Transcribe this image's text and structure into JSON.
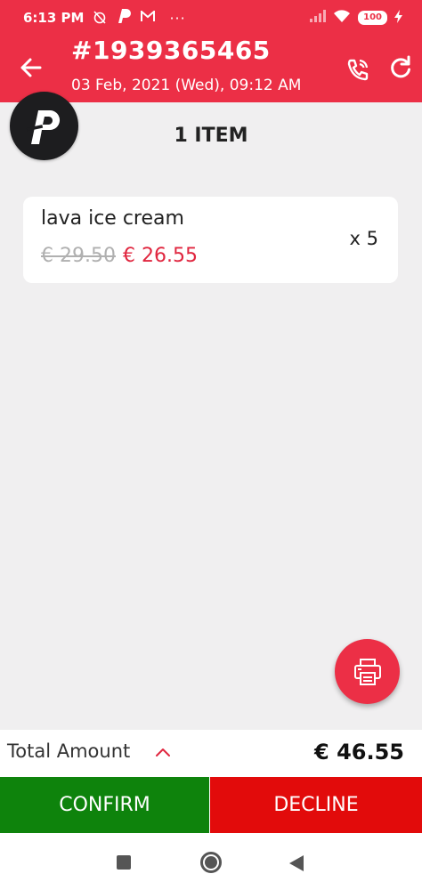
{
  "status_bar": {
    "time": "6:13 PM",
    "battery": "100"
  },
  "header": {
    "order_number": "#1939365465",
    "order_datetime": "03 Feb, 2021 (Wed), 09:12 AM"
  },
  "brand": {
    "logo_letter": "P"
  },
  "items_title": "1 ITEM",
  "items": [
    {
      "name": "lava ice cream",
      "price_original": "€ 29.50",
      "price_discounted": "€ 26.55",
      "quantity": "x 5"
    }
  ],
  "totals": {
    "label": "Total Amount",
    "value": "€ 46.55"
  },
  "actions": {
    "confirm_label": "CONFIRM",
    "decline_label": "DECLINE"
  },
  "colors": {
    "header_bg": "#ec2f46",
    "accent_red": "#e0263f",
    "confirm_green": "#0e830c",
    "decline_red": "#e20b0b",
    "page_bg": "#f0eff0"
  }
}
